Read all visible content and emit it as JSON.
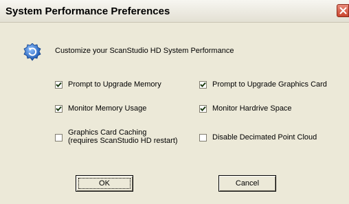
{
  "window": {
    "title": "System Performance Preferences"
  },
  "header": {
    "text": "Customize your ScanStudio HD System Performance",
    "icon": "refresh-icon"
  },
  "options": [
    {
      "label": "Prompt to Upgrade Memory",
      "checked": true
    },
    {
      "label": "Prompt to Upgrade Graphics Card",
      "checked": true
    },
    {
      "label": "Monitor Memory Usage",
      "checked": true
    },
    {
      "label": "Monitor Hardrive Space",
      "checked": true
    },
    {
      "label_line1": "Graphics Card Caching",
      "label_line2": "(requires ScanStudio HD restart)",
      "checked": false
    },
    {
      "label": "Disable Decimated Point Cloud",
      "checked": false
    }
  ],
  "buttons": {
    "ok": "OK",
    "cancel": "Cancel"
  },
  "colors": {
    "dialog_bg": "#ece9d8",
    "close_button": "#c9442d",
    "icon_blue": "#2a6fc9"
  }
}
